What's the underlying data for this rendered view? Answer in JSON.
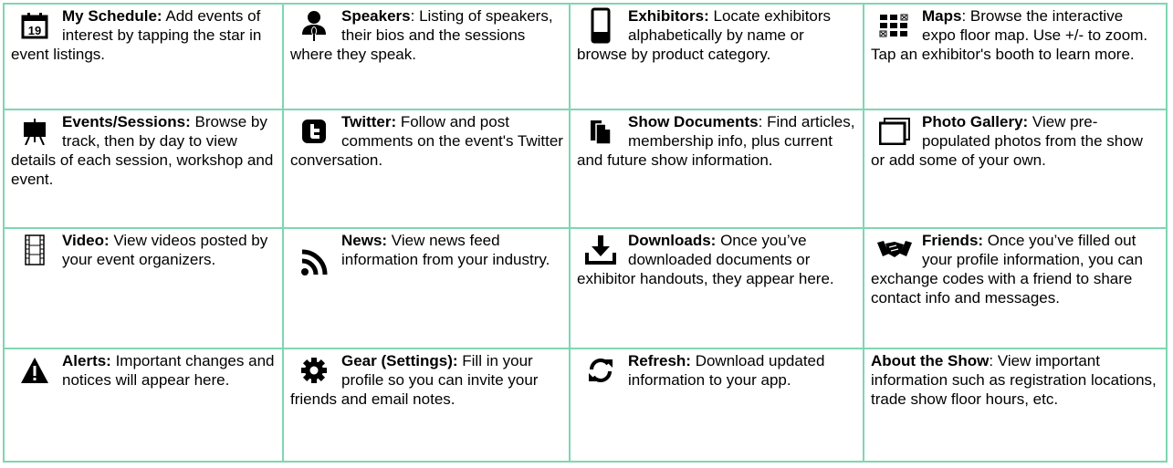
{
  "cells": [
    {
      "icon": "calendar-icon",
      "icon_text": "19",
      "title": "My Schedule:",
      "body": " Add events of interest by tapping the star in event listings."
    },
    {
      "icon": "speaker-icon",
      "title": "Speakers",
      "body": ": Listing of speakers, their bios and the sessions where they speak."
    },
    {
      "icon": "mobile-device-icon",
      "title": "Exhibitors:",
      "body": " Locate exhibitors alphabetically by name or browse by product category."
    },
    {
      "icon": "map-grid-icon",
      "title": "Maps",
      "body": ": Browse the interactive expo floor map. Use +/- to zoom. Tap an exhibitor's booth to learn more."
    },
    {
      "icon": "easel-icon",
      "title": "Events/Sessions:",
      "body": " Browse by track, then by day to view details of each session, workshop and event."
    },
    {
      "icon": "twitter-icon",
      "title": "Twitter:",
      "body": " Follow and post comments on the event's Twitter conversation."
    },
    {
      "icon": "documents-icon",
      "title": "Show Documents",
      "body": ": Find articles, membership info, plus current and future show information."
    },
    {
      "icon": "photo-gallery-icon",
      "title": "Photo Gallery:",
      "body": " View pre-populated photos from the show or add some of your own."
    },
    {
      "icon": "film-icon",
      "title": "Video:",
      "body": " View videos posted by your event organizers."
    },
    {
      "icon": "rss-icon",
      "title": "News:",
      "body": " View news feed information from your industry."
    },
    {
      "icon": "download-icon",
      "title": "Downloads:",
      "body": " Once you’ve downloaded documents or exhibitor handouts, they appear here."
    },
    {
      "icon": "handshake-icon",
      "title": "Friends:",
      "body": " Once you’ve filled out your profile information, you can exchange codes with a friend to share contact info and messages."
    },
    {
      "icon": "alert-icon",
      "title": "Alerts:",
      "body": " Important changes and notices will appear here."
    },
    {
      "icon": "gear-icon",
      "title": "Gear (Settings):",
      "body": " Fill in your profile so you can invite your friends and email notes."
    },
    {
      "icon": "refresh-icon",
      "title": "Refresh:",
      "body": " Download updated information to your app."
    },
    {
      "icon": "",
      "title": "About the Show",
      "body": ": View important information such as registration locations, trade show floor hours, etc."
    }
  ]
}
